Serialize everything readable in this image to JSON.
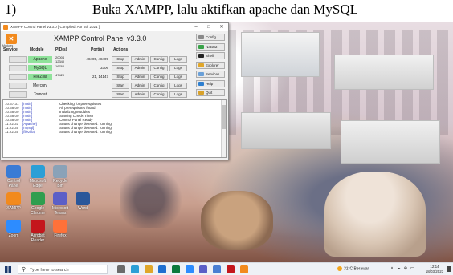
{
  "heading": {
    "number": "1)",
    "text": "Buka XAMPP, lalu aktifkan apache dan MySQL"
  },
  "xampp": {
    "window_title": "XAMPP Control Panel v3.3.0   [ Compiled: Apr 6th 2021 ]",
    "window_controls": [
      "–",
      "□",
      "✕"
    ],
    "logo_glyph": "✕",
    "modules_label": "Modules",
    "panel_title": "XAMPP Control Panel v3.3.0",
    "columns": {
      "service": "Service",
      "module": "Module",
      "pid": "PID(s)",
      "port": "Port(s)",
      "actions": "Actions"
    },
    "rows": [
      {
        "module": "Apache",
        "running": true,
        "pid_line1": "20004",
        "pid_line2": "12340",
        "ports": "48405, 48409",
        "start": "Stop",
        "admin": "Admin",
        "config": "Config",
        "logs": "Logs"
      },
      {
        "module": "MySQL",
        "running": true,
        "pid_line1": "16760",
        "pid_line2": "",
        "ports": "3306",
        "start": "Stop",
        "admin": "Admin",
        "config": "Config",
        "logs": "Logs"
      },
      {
        "module": "FileZilla",
        "running": true,
        "pid_line1": "47420",
        "pid_line2": "",
        "ports": "21, 14147",
        "start": "Stop",
        "admin": "Admin",
        "config": "Config",
        "logs": "Logs"
      },
      {
        "module": "Mercury",
        "running": false,
        "pid_line1": "",
        "pid_line2": "",
        "ports": "",
        "start": "Start",
        "admin": "Admin",
        "config": "Config",
        "logs": "Logs"
      },
      {
        "module": "Tomcat",
        "running": false,
        "pid_line1": "",
        "pid_line2": "",
        "ports": "",
        "start": "Start",
        "admin": "Admin",
        "config": "Config",
        "logs": "Logs"
      }
    ],
    "side_buttons": [
      "Config",
      "Netstat",
      "Shell",
      "Explorer",
      "Services",
      "Help",
      "Quit"
    ],
    "side_colors": [
      "#8a8a8a",
      "#3aa34a",
      "#222222",
      "#e0a62a",
      "#6aa0d8",
      "#2d7fd0",
      "#d8a12a"
    ],
    "log": [
      {
        "time": "10:37:31",
        "src": "[main]",
        "msg": "Checking for prerequisites"
      },
      {
        "time": "10:38:00",
        "src": "[main]",
        "msg": "All prerequisites found"
      },
      {
        "time": "10:38:00",
        "src": "[main]",
        "msg": "Initializing Modules"
      },
      {
        "time": "10:38:00",
        "src": "[main]",
        "msg": "Starting Check-Timer"
      },
      {
        "time": "10:38:00",
        "src": "[main]",
        "msg": "Control Panel Ready"
      },
      {
        "time": "11:22:31",
        "src": "[Apache]",
        "msg": "Status change detected: running"
      },
      {
        "time": "11:22:35",
        "src": "[mysql]",
        "msg": "Status change detected: running"
      },
      {
        "time": "11:22:35",
        "src": "[filezilla]",
        "msg": "Status change detected: running"
      }
    ]
  },
  "desktop_icons": [
    {
      "label": "Control Panel",
      "color": "#3a7bd5"
    },
    {
      "label": "Microsoft Edge",
      "color": "#2b9fd6"
    },
    {
      "label": "Recycle Bin",
      "color": "#8aa2b8"
    },
    {
      "label": "XAMPP",
      "color": "#f28a1d"
    },
    {
      "label": "Google Chrome",
      "color": "#2f9e4f"
    },
    {
      "label": "Microsoft Teams",
      "color": "#5b5fc7"
    },
    {
      "label": "Zoom",
      "color": "#2d8cff"
    },
    {
      "label": "Acrobat Reader",
      "color": "#c4161c"
    },
    {
      "label": "Firefox",
      "color": "#ff7139"
    },
    {
      "label": "Word",
      "color": "#2b579a"
    }
  ],
  "taskbar": {
    "search_placeholder": "Type here to search",
    "search_glyph": "⚲",
    "apps": [
      "#6b6b6b",
      "#2b9fd6",
      "#e0a62a",
      "#1f6fd0",
      "#0d7a3e",
      "#2d8cff",
      "#5b5fc7",
      "#4a7fd3",
      "#c4161c",
      "#f28a1d"
    ],
    "weather": "31°C  Berawan",
    "tray": "∧ ☁ ⊕ ▭",
    "time": "12:14",
    "date": "18/03/2023"
  }
}
